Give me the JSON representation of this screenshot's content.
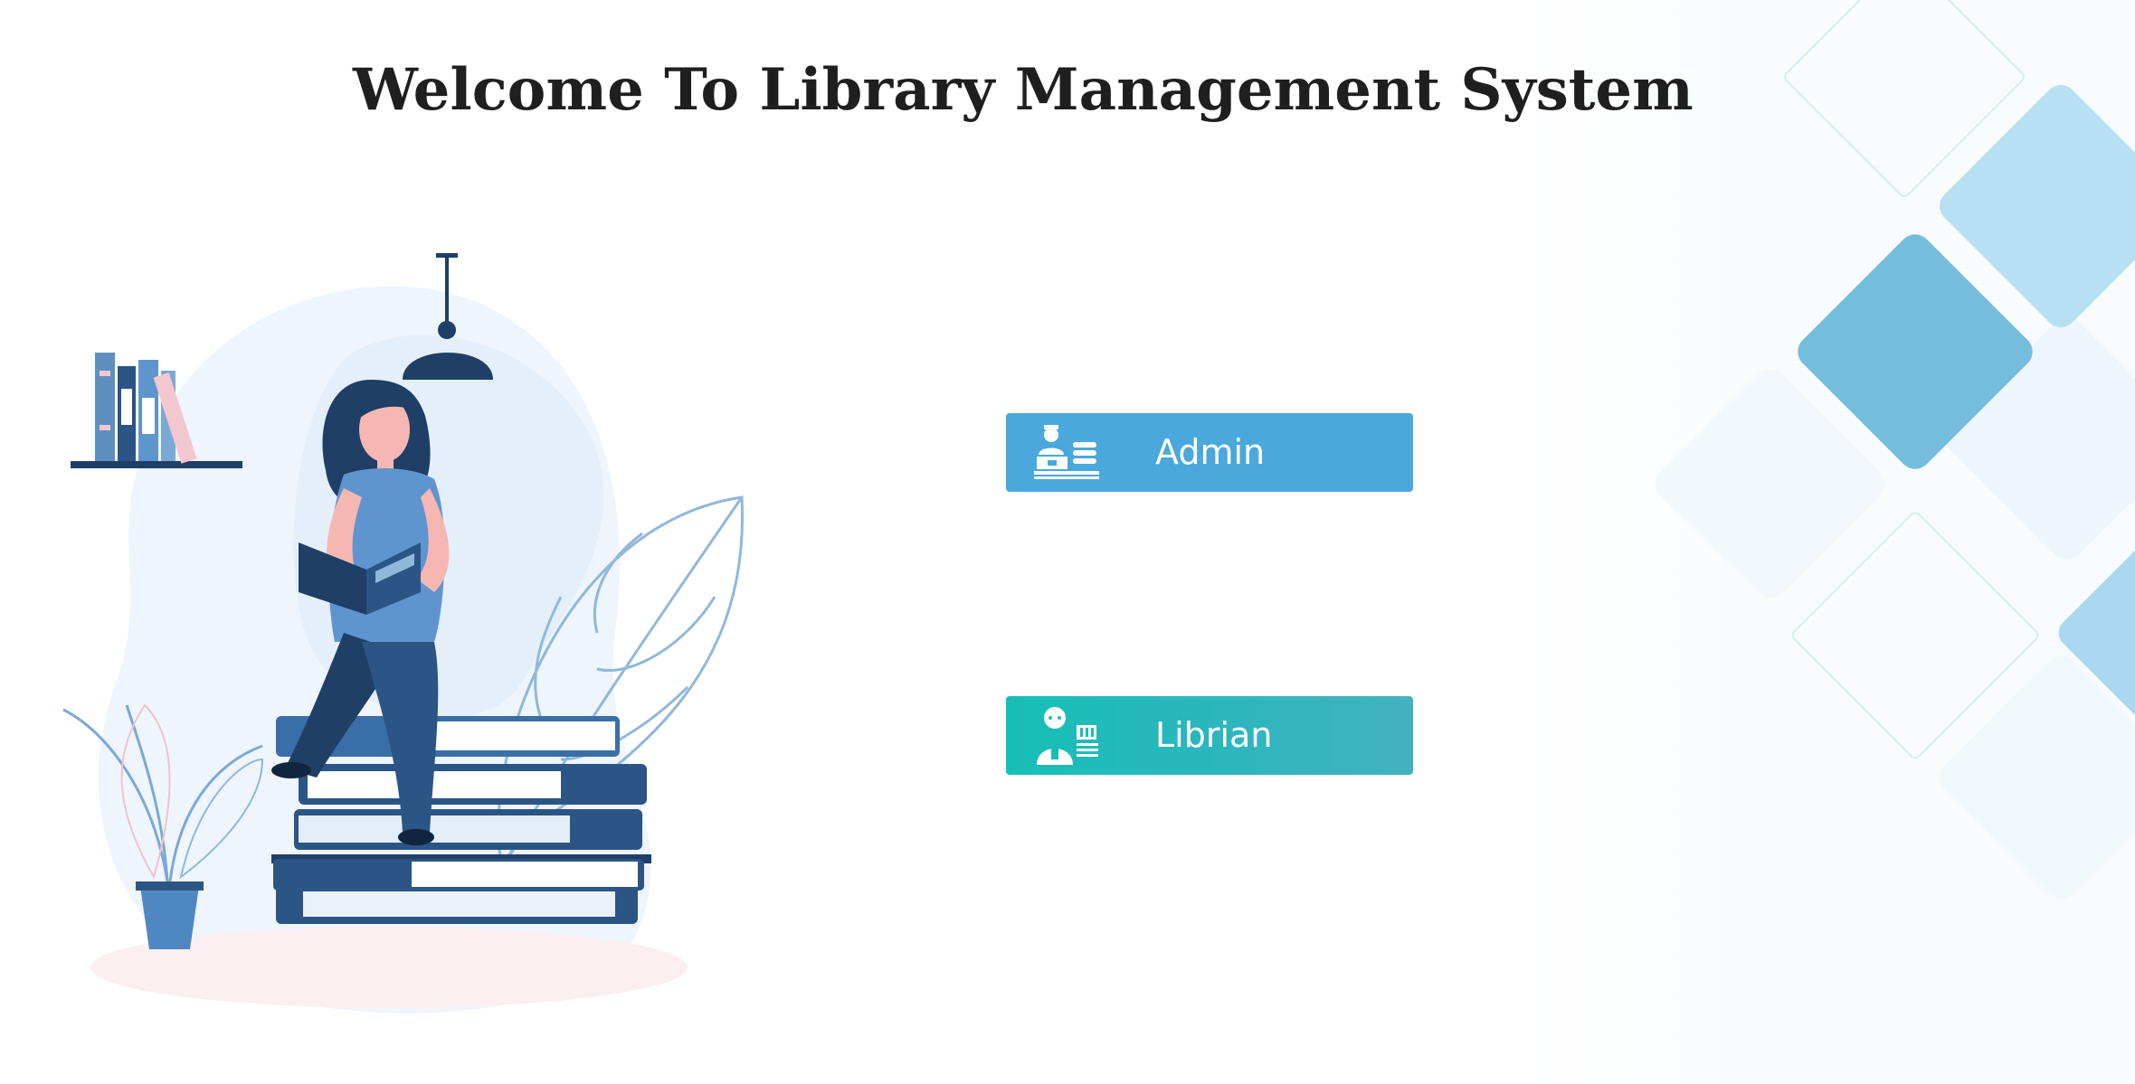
{
  "page": {
    "title": "Welcome To Library Management System"
  },
  "roles": {
    "admin": {
      "label": "Admin",
      "icon": "admin-desk-icon",
      "color": "#4aa8dd"
    },
    "librarian": {
      "label": "Librian",
      "icon": "librarian-icon",
      "color": "#16bfb6"
    }
  },
  "illustration": {
    "subject": "woman-reading-on-books-illustration"
  },
  "colors": {
    "background": "#ffffff",
    "title_text": "#1f1f1f",
    "diamond_accent": "#75bddc",
    "diamond_light": "#b7e0f3"
  }
}
